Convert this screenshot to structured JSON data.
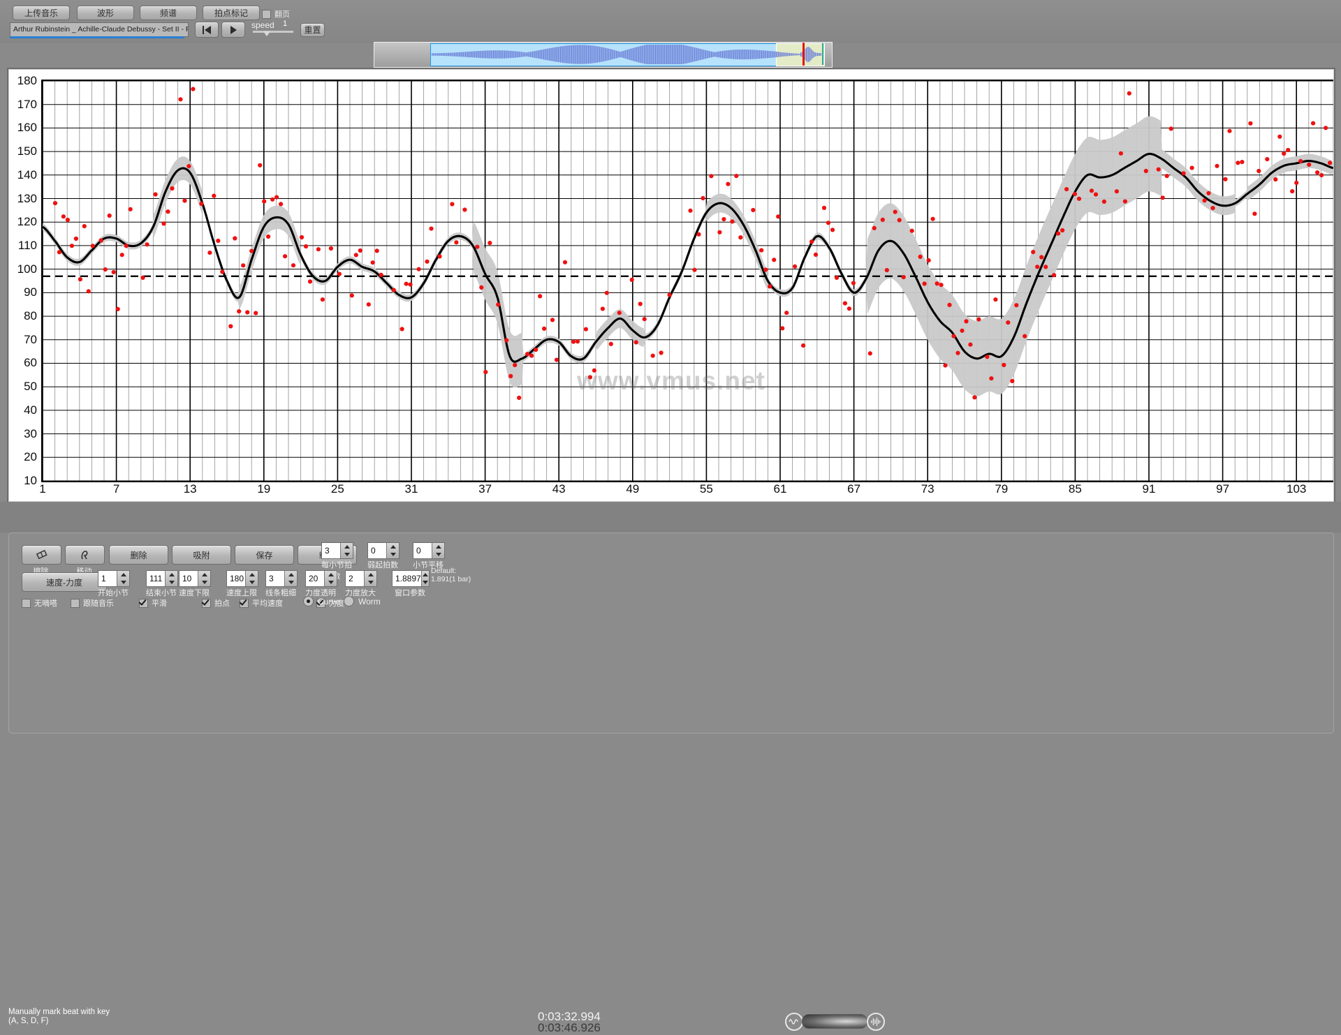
{
  "toolbar": {
    "upload_label": "上传音乐",
    "waveform_label": "波形",
    "spectrum_label": "频谱",
    "beatmark_label": "拍点标记",
    "flip_label": "翻页",
    "song_title": "Arthur Rubinstein _ Achille-Claude Debussy - Set II - Poisso",
    "rewind_icon": "skip-back-icon",
    "play_icon": "play-icon",
    "speed_label": "speed",
    "speed_value": "1",
    "reset_label": "重置"
  },
  "navigator": {
    "icon": "waveform-navigator"
  },
  "chart_data": {
    "type": "line",
    "title": "",
    "xlabel": "",
    "ylabel": "",
    "xlim": [
      1,
      106
    ],
    "ylim": [
      10,
      180
    ],
    "yticks": [
      180,
      170,
      160,
      150,
      140,
      130,
      120,
      110,
      100,
      90,
      80,
      70,
      60,
      50,
      40,
      30,
      20,
      10
    ],
    "xticks": [
      1,
      7,
      13,
      19,
      25,
      31,
      37,
      43,
      49,
      55,
      61,
      67,
      73,
      79,
      85,
      91,
      97,
      103
    ],
    "grid": true,
    "legend": "none",
    "watermark": "www.vmus.net",
    "reference_line": {
      "value": 97,
      "style": "dashed",
      "color": "#000000"
    },
    "series": [
      {
        "name": "smoothed tempo curve",
        "color": "#000000",
        "x": [
          1,
          2,
          3,
          4,
          5,
          6,
          7,
          8,
          9,
          10,
          11,
          12,
          13,
          14,
          15,
          16,
          17,
          18,
          19,
          20,
          21,
          22,
          23,
          24,
          25,
          26,
          27,
          28,
          29,
          30,
          31,
          32,
          33,
          34,
          35,
          36,
          37,
          38,
          39,
          40,
          41,
          42,
          43,
          44,
          45,
          46,
          47,
          48,
          49,
          50,
          51,
          52,
          53,
          54,
          55,
          56,
          57,
          58,
          59,
          60,
          61,
          62,
          63,
          64,
          65,
          66,
          67,
          68,
          69,
          70,
          71,
          72,
          73,
          74,
          75,
          76,
          77,
          78,
          79,
          80,
          81,
          82,
          83,
          84,
          85,
          86,
          87,
          88,
          89,
          90,
          91,
          92,
          93,
          94,
          95,
          96,
          97,
          98,
          99,
          100,
          101,
          102,
          103,
          104,
          105,
          106
        ],
        "values": [
          118,
          112,
          105,
          103,
          108,
          113,
          113,
          110,
          111,
          118,
          133,
          142,
          141,
          128,
          110,
          95,
          88,
          104,
          118,
          122,
          119,
          106,
          97,
          95,
          101,
          104,
          101,
          99,
          94,
          89,
          88,
          94,
          104,
          112,
          114,
          110,
          98,
          88,
          63,
          62,
          66,
          70,
          69,
          63,
          62,
          69,
          75,
          79,
          74,
          71,
          76,
          88,
          99,
          113,
          124,
          128,
          126,
          119,
          108,
          95,
          90,
          92,
          105,
          114,
          109,
          98,
          90,
          96,
          108,
          112,
          107,
          97,
          86,
          78,
          73,
          65,
          62,
          64,
          63,
          71,
          85,
          98,
          110,
          122,
          133,
          140,
          139,
          140,
          143,
          146,
          149,
          147,
          143,
          139,
          133,
          129,
          127,
          128,
          132,
          136,
          141,
          144,
          145,
          146,
          145,
          143
        ]
      },
      {
        "name": "beat tempo points",
        "color": "#ee1111",
        "marker": "dot",
        "note": "scattered red dots, 60-180 BPM range across all bars"
      },
      {
        "name": "confidence band",
        "color": "#c8c8c8",
        "note": "grey shaded envelope around the smoothed curve"
      }
    ]
  },
  "status": {
    "hint_line1": "Manually mark beat with key",
    "hint_line2": "(A, S, D, F)",
    "time_current": "0:03:32.994",
    "time_total": "0:03:46.926",
    "volume_left_icon": "wave-low-icon",
    "volume_right_icon": "wave-high-icon"
  },
  "bottom": {
    "tools": [
      {
        "icon": "eraser-icon",
        "caption": "擦除"
      },
      {
        "icon": "move-icon",
        "caption": "移动"
      }
    ],
    "actions": [
      {
        "label": "删除"
      },
      {
        "label": "吸附"
      },
      {
        "label": "保存"
      },
      {
        "label": "载入"
      }
    ],
    "mode_button": "速度-力度",
    "spinners_row1": [
      {
        "value": "3",
        "caption": "每小节拍数"
      },
      {
        "value": "0",
        "caption": "弱起拍数"
      },
      {
        "value": "0",
        "caption": "小节平移"
      }
    ],
    "spinners_row2": [
      {
        "value": "1",
        "caption": "开始小节"
      },
      {
        "value": "111",
        "caption": "结束小节"
      },
      {
        "value": "10",
        "caption": "速度下限"
      },
      {
        "value": "180",
        "caption": "速度上限"
      },
      {
        "value": "3",
        "caption": "线条粗细"
      },
      {
        "value": "20",
        "caption": "力度透明"
      },
      {
        "value": "2",
        "caption": "力度放大"
      },
      {
        "value": "1.8897",
        "caption": "窗口参数"
      }
    ],
    "default_line1": "Default:",
    "default_line2": "1.891(1 bar)",
    "checkboxes": [
      {
        "label": "无嘀嗒",
        "checked": false
      },
      {
        "label": "跟随音乐",
        "checked": false
      },
      {
        "label": "平滑",
        "checked": true
      },
      {
        "label": "拍点",
        "checked": true
      },
      {
        "label": "平均速度",
        "checked": true
      },
      {
        "label": "力度",
        "checked": true
      }
    ],
    "radios": [
      {
        "label": "Curve",
        "selected": true
      },
      {
        "label": "Worm",
        "selected": false
      }
    ]
  }
}
